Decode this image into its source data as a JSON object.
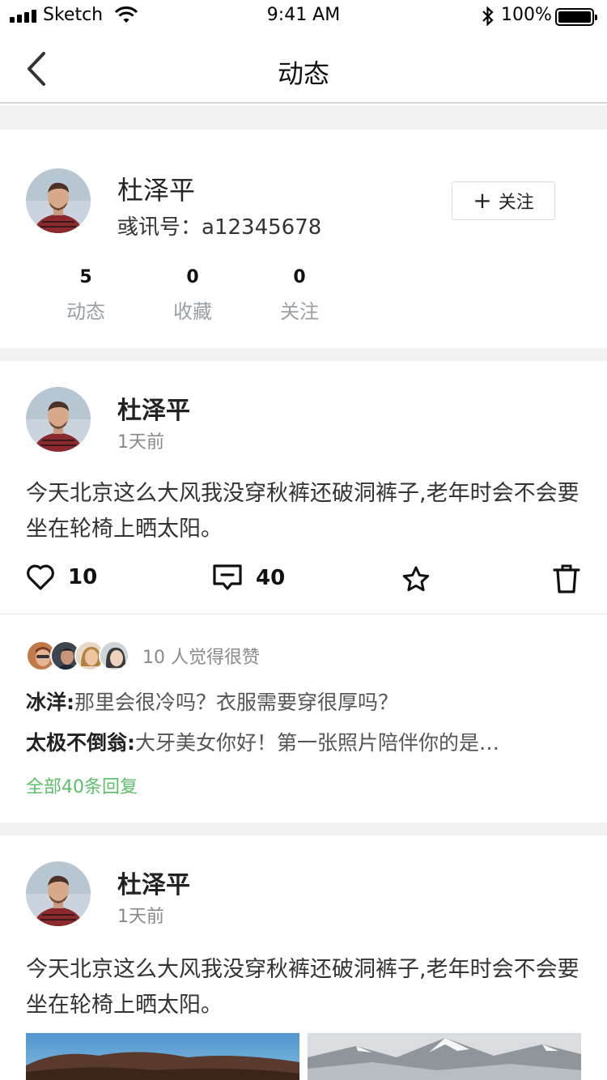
{
  "status_bar": {
    "carrier": "Sketch",
    "time": "9:41 AM",
    "battery_pct": "100%"
  },
  "nav": {
    "title": "动态"
  },
  "profile": {
    "name": "杜泽平",
    "uid_label": "彧讯号：",
    "uid_value": "a12345678",
    "follow_label": "关注",
    "stats": [
      {
        "num": "5",
        "label": "动态"
      },
      {
        "num": "0",
        "label": "收藏"
      },
      {
        "num": "0",
        "label": "关注"
      }
    ]
  },
  "posts": [
    {
      "name": "杜泽平",
      "time": "1天前",
      "text": "今天北京这么大风我没穿秋裤还破洞裤子,老年时会不会要坐在轮椅上晒太阳。",
      "likes": "10",
      "comments": "40",
      "liked_by": "10 人觉得很赞",
      "replies": [
        {
          "author": "冰洋",
          "text": "那里会很冷吗？衣服需要穿很厚吗？"
        },
        {
          "author": "太极不倒翁",
          "text": "大牙美女你好！第一张照片陪伴你的是…"
        }
      ],
      "all_replies": "全部40条回复"
    },
    {
      "name": "杜泽平",
      "time": "1天前",
      "text": "今天北京这么大风我没穿秋裤还破洞裤子,老年时会不会要坐在轮椅上晒太阳。"
    }
  ],
  "colors": {
    "accent_green": "#5cbf6a",
    "muted": "#98a0a6",
    "gap_bg": "#f2f2f2"
  }
}
